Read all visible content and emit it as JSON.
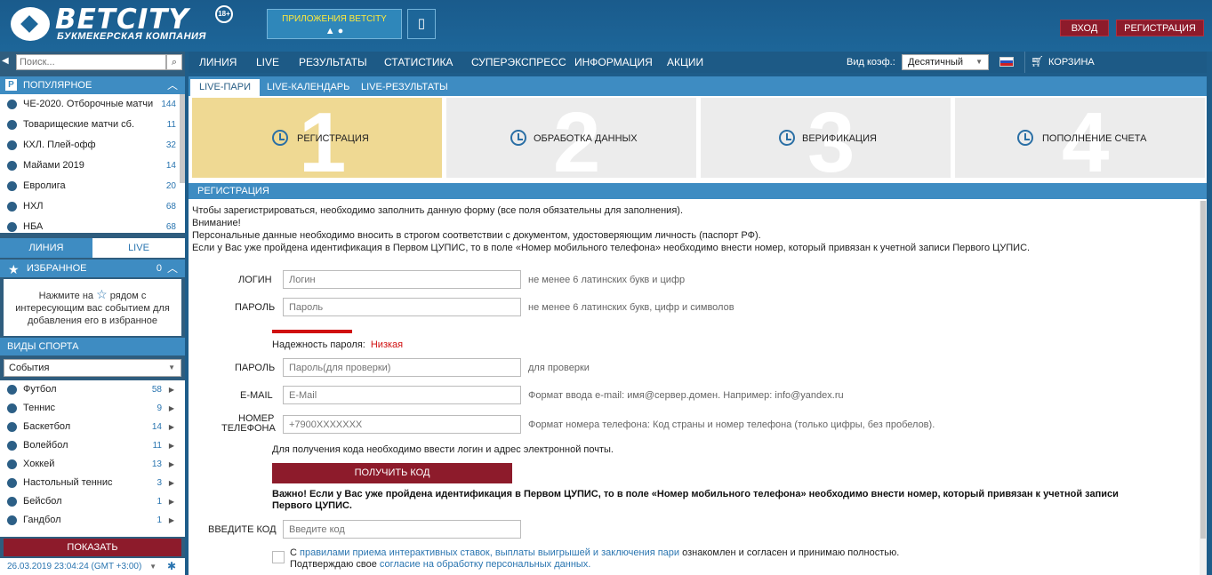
{
  "header": {
    "logo_text": "BETCITY",
    "logo_sub": "БУКМЕКЕРСКАЯ КОМПАНИЯ",
    "age": "18+",
    "apps_label": "ПРИЛОЖЕНИЯ BETCITY",
    "login": "ВХОД",
    "register": "РЕГИСТРАЦИЯ"
  },
  "search": {
    "placeholder": "Поиск..."
  },
  "popular": {
    "title": "ПОПУЛЯРНОЕ",
    "items": [
      {
        "label": "ЧЕ-2020. Отборочные матчи",
        "count": "144"
      },
      {
        "label": "Товарищеские матчи сб.",
        "count": "11"
      },
      {
        "label": "КХЛ. Плей-офф",
        "count": "32"
      },
      {
        "label": "Майами 2019",
        "count": "14"
      },
      {
        "label": "Евролига",
        "count": "20"
      },
      {
        "label": "НХЛ",
        "count": "68"
      },
      {
        "label": "НБА",
        "count": "68"
      }
    ]
  },
  "side_tabs": {
    "line": "ЛИНИЯ",
    "live": "LIVE"
  },
  "favorites": {
    "title": "ИЗБРАННОЕ",
    "count": "0",
    "text_before": "Нажмите на",
    "text_after": "рядом с интересующим вас событием для добавления его в избранное"
  },
  "sports": {
    "title": "ВИДЫ СПОРТА",
    "select": "События",
    "items": [
      {
        "label": "Футбол",
        "count": "58"
      },
      {
        "label": "Теннис",
        "count": "9"
      },
      {
        "label": "Баскетбол",
        "count": "14"
      },
      {
        "label": "Волейбол",
        "count": "11"
      },
      {
        "label": "Хоккей",
        "count": "13"
      },
      {
        "label": "Настольный теннис",
        "count": "3"
      },
      {
        "label": "Бейсбол",
        "count": "1"
      },
      {
        "label": "Гандбол",
        "count": "1"
      }
    ]
  },
  "show_button": "ПОКАЗАТЬ",
  "datetime": "26.03.2019 23:04:24 (GMT +3:00)",
  "nav": {
    "items": [
      "ЛИНИЯ",
      "LIVE",
      "РЕЗУЛЬТАТЫ",
      "СТАТИСТИКА",
      "СУПЕРЭКСПРЕСС",
      "ИНФОРМАЦИЯ",
      "АКЦИИ"
    ],
    "koef_label": "Вид коэф.:",
    "koef_value": "Десятичный",
    "cart": "КОРЗИНА"
  },
  "subtabs": [
    "LIVE-ПАРИ",
    "LIVE-КАЛЕНДАРЬ",
    "LIVE-РЕЗУЛЬТАТЫ"
  ],
  "steps": [
    {
      "num": "1",
      "label": "РЕГИСТРАЦИЯ"
    },
    {
      "num": "2",
      "label": "ОБРАБОТКА ДАННЫХ"
    },
    {
      "num": "3",
      "label": "ВЕРИФИКАЦИЯ"
    },
    {
      "num": "4",
      "label": "ПОПОЛНЕНИЕ СЧЕТА"
    }
  ],
  "registration": {
    "title": "РЕГИСТРАЦИЯ",
    "intro1": "Чтобы зарегистрироваться, необходимо заполнить данную форму (все поля обязательны для заполнения).",
    "intro2": "Внимание!",
    "intro3": "Персональные данные необходимо вносить в строгом соответствии с документом, удостоверяющим личность (паспорт РФ).",
    "intro4": "Если у Вас уже пройдена идентификация в Первом ЦУПИС, то в поле «Номер мобильного телефона» необходимо внести номер, который привязан к учетной записи Первого ЦУПИС.",
    "fields": {
      "login": {
        "label": "ЛОГИН",
        "placeholder": "Логин",
        "hint": "не менее 6 латинских букв и цифр"
      },
      "password": {
        "label": "ПАРОЛЬ",
        "placeholder": "Пароль",
        "hint": "не менее 6 латинских букв, цифр и символов"
      },
      "password2": {
        "label": "ПАРОЛЬ",
        "placeholder": "Пароль(для проверки)",
        "hint": "для проверки"
      },
      "email": {
        "label": "E-MAIL",
        "placeholder": "E-Mail",
        "hint": "Формат ввода e-mail: имя@сервер.домен. Например: info@yandex.ru"
      },
      "phone": {
        "label1": "НОМЕР",
        "label2": "ТЕЛЕФОНА",
        "placeholder": "+7900XXXXXXX",
        "hint": "Формат номера телефона: Код страны и номер телефона (только цифры, без пробелов)."
      },
      "code": {
        "label": "ВВЕДИТЕ КОД",
        "placeholder": "Введите код"
      }
    },
    "strength_label": "Надежность пароля:",
    "strength_value": "Низкая",
    "code_note": "Для получения кода необходимо ввести логин и адрес электронной почты.",
    "get_code": "ПОЛУЧИТЬ КОД",
    "warning": "Важно! Если у Вас уже пройдена идентификация в Первом ЦУПИС, то в поле «Номер мобильного телефона» необходимо внести номер, который привязан к учетной записи Первого ЦУПИС.",
    "agree_c": "С",
    "agree_link1": "правилами приема интерактивных ставок, выплаты выигрышей и заключения пари",
    "agree_rest1": "ознакомлен и согласен и принимаю полностью.",
    "agree_rest2": "Подтверждаю свое",
    "agree_link2": "согласие на обработку персональных данных."
  }
}
